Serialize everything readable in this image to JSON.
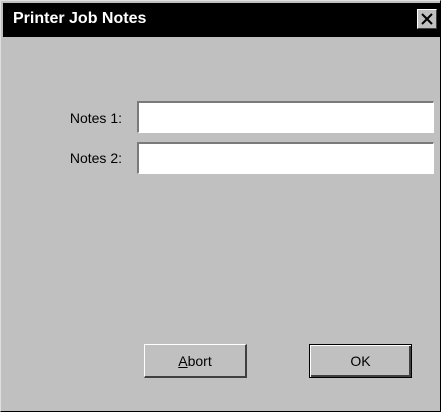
{
  "window": {
    "title": "Printer Job Notes",
    "close_icon": "close-icon"
  },
  "fields": [
    {
      "label": "Notes 1:",
      "value": "",
      "placeholder": ""
    },
    {
      "label": "Notes 2:",
      "value": "",
      "placeholder": ""
    }
  ],
  "buttons": {
    "abort": {
      "mnemonic": "A",
      "rest": "bort"
    },
    "ok": {
      "label": "OK"
    }
  },
  "colors": {
    "face": "#c0c0c0",
    "titlebar": "#000000",
    "title_text": "#ffffff",
    "input_background": "#ffffff"
  }
}
